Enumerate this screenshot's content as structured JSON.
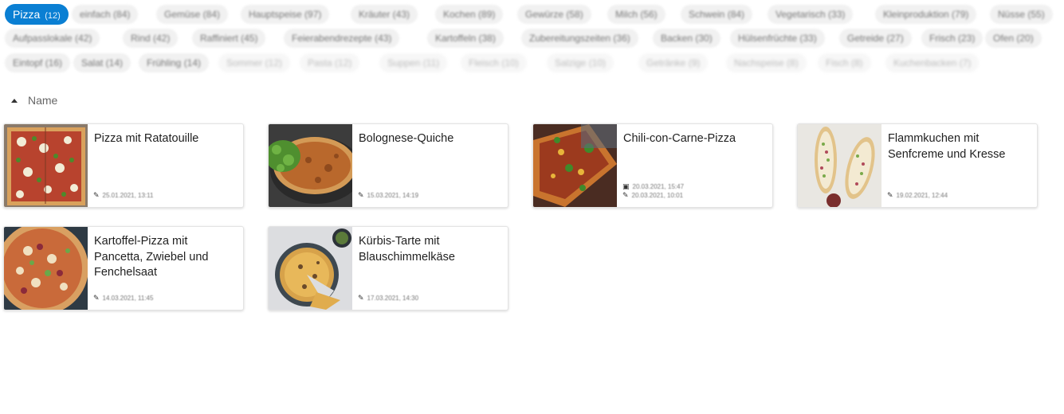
{
  "tags": {
    "active": {
      "label": "Pizza",
      "count": "(12)"
    },
    "items": [
      "einfach (84)",
      "Gemüse (84)",
      "Hauptspeise (97)",
      "Kräuter (43)",
      "Kochen (89)",
      "Gewürze (58)",
      "Milch (56)",
      "Schwein (84)",
      "Vegetarisch (33)",
      "Kleinproduktion (79)",
      "Nüsse (55)",
      "Aufpasslokale (42)",
      "Rind (42)",
      "Raffiniert (45)",
      "Feierabendrezepte (43)",
      "Kartoffeln (38)",
      "Zubereitungszeiten (36)",
      "Backen (30)",
      "Hülsenfrüchte (33)",
      "Getreide (27)",
      "Frisch (23)",
      "Ofen (20)",
      "Eintopf (16)",
      "Salat (14)",
      "Frühling (14)"
    ],
    "faint_items": [
      "Sommer (12)",
      "Pasta (12)",
      "Suppen (11)",
      "Fleisch (10)",
      "Salzige (10)",
      "Getränke (9)",
      "Nachspeise (8)",
      "Fisch (8)",
      "Kuchenbacken (7)"
    ]
  },
  "sort": {
    "label": "Name"
  },
  "cards": [
    {
      "title": "Pizza mit Ratatouille",
      "meta": [
        "25.01.2021, 13:11"
      ]
    },
    {
      "title": "Bolognese-Quiche",
      "meta": [
        "15.03.2021, 14:19"
      ]
    },
    {
      "title": "Chili-con-Carne-Pizza",
      "meta": [
        "20.03.2021, 15:47",
        "20.03.2021, 10:01"
      ]
    },
    {
      "title": "Flammkuchen mit Senfcreme und Kresse",
      "meta": [
        "19.02.2021, 12:44"
      ]
    },
    {
      "title": "Kartoffel-Pizza mit Pancetta, Zwiebel und Fenchelsaat",
      "meta": [
        "14.03.2021, 11:45"
      ]
    },
    {
      "title": "Kürbis-Tarte mit Blauschimmelkäse",
      "meta": [
        "17.03.2021, 14:30"
      ]
    }
  ],
  "icons": {
    "edit": "pencil-icon",
    "calendar": "calendar-icon",
    "sort": "sort-ascending-icon"
  },
  "colors": {
    "accent": "#0a7fd3"
  }
}
